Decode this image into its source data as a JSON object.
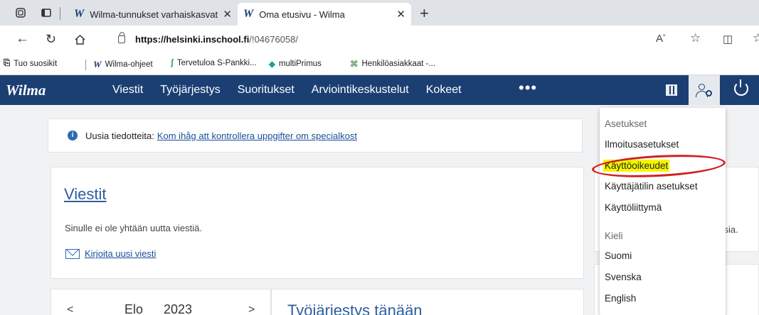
{
  "browser": {
    "tabs": [
      {
        "title": "Wilma-tunnukset varhaiskasvatu",
        "logo": "W"
      },
      {
        "title": "Oma etusivu - Wilma",
        "logo": "W"
      }
    ],
    "url_host": "https://helsinki.inschool.fi",
    "url_path": "/!04676058/",
    "bookmarks": [
      {
        "label": "Tuo suosikit",
        "icon": "import-icon"
      },
      {
        "label": "Wilma-ohjeet",
        "icon": "W"
      },
      {
        "label": "Tervetuloa S-Pankki...",
        "icon": "s-pankki-icon"
      },
      {
        "label": "multiPrimus",
        "icon": "multiprimus-icon"
      },
      {
        "label": "Henkilöasiakkaat -...",
        "icon": "bank-icon"
      }
    ]
  },
  "wilma": {
    "logo": "Wilma",
    "nav": [
      "Viestit",
      "Työjärjestys",
      "Suoritukset",
      "Arviointikeskustelut",
      "Kokeet"
    ],
    "more": "•••"
  },
  "notice": {
    "label": "Uusia tiedotteita:",
    "link": "Kom ihåg att kontrollera uppgifter om specialkost"
  },
  "messages": {
    "title": "Viestit",
    "empty": "Sinulle ei ole yhtään uutta viestiä.",
    "write": "Kirjoita uusi viesti"
  },
  "calendar": {
    "prev": "<",
    "month": "Elo",
    "year": "2023",
    "next": ">"
  },
  "schedule": {
    "title": "Työjärjestys tänään"
  },
  "side": {
    "fragment": "ksia."
  },
  "menu": {
    "settings_header": "Asetukset",
    "items": [
      "Ilmoitusasetukset",
      "Käyttöoikeudet",
      "Käyttäjätilin asetukset",
      "Käyttöliittymä"
    ],
    "language_header": "Kieli",
    "languages": [
      "Suomi",
      "Svenska",
      "English"
    ]
  },
  "colors": {
    "header": "#1b3f73",
    "highlight": "#f6f600",
    "annotation": "#d21f1f"
  }
}
